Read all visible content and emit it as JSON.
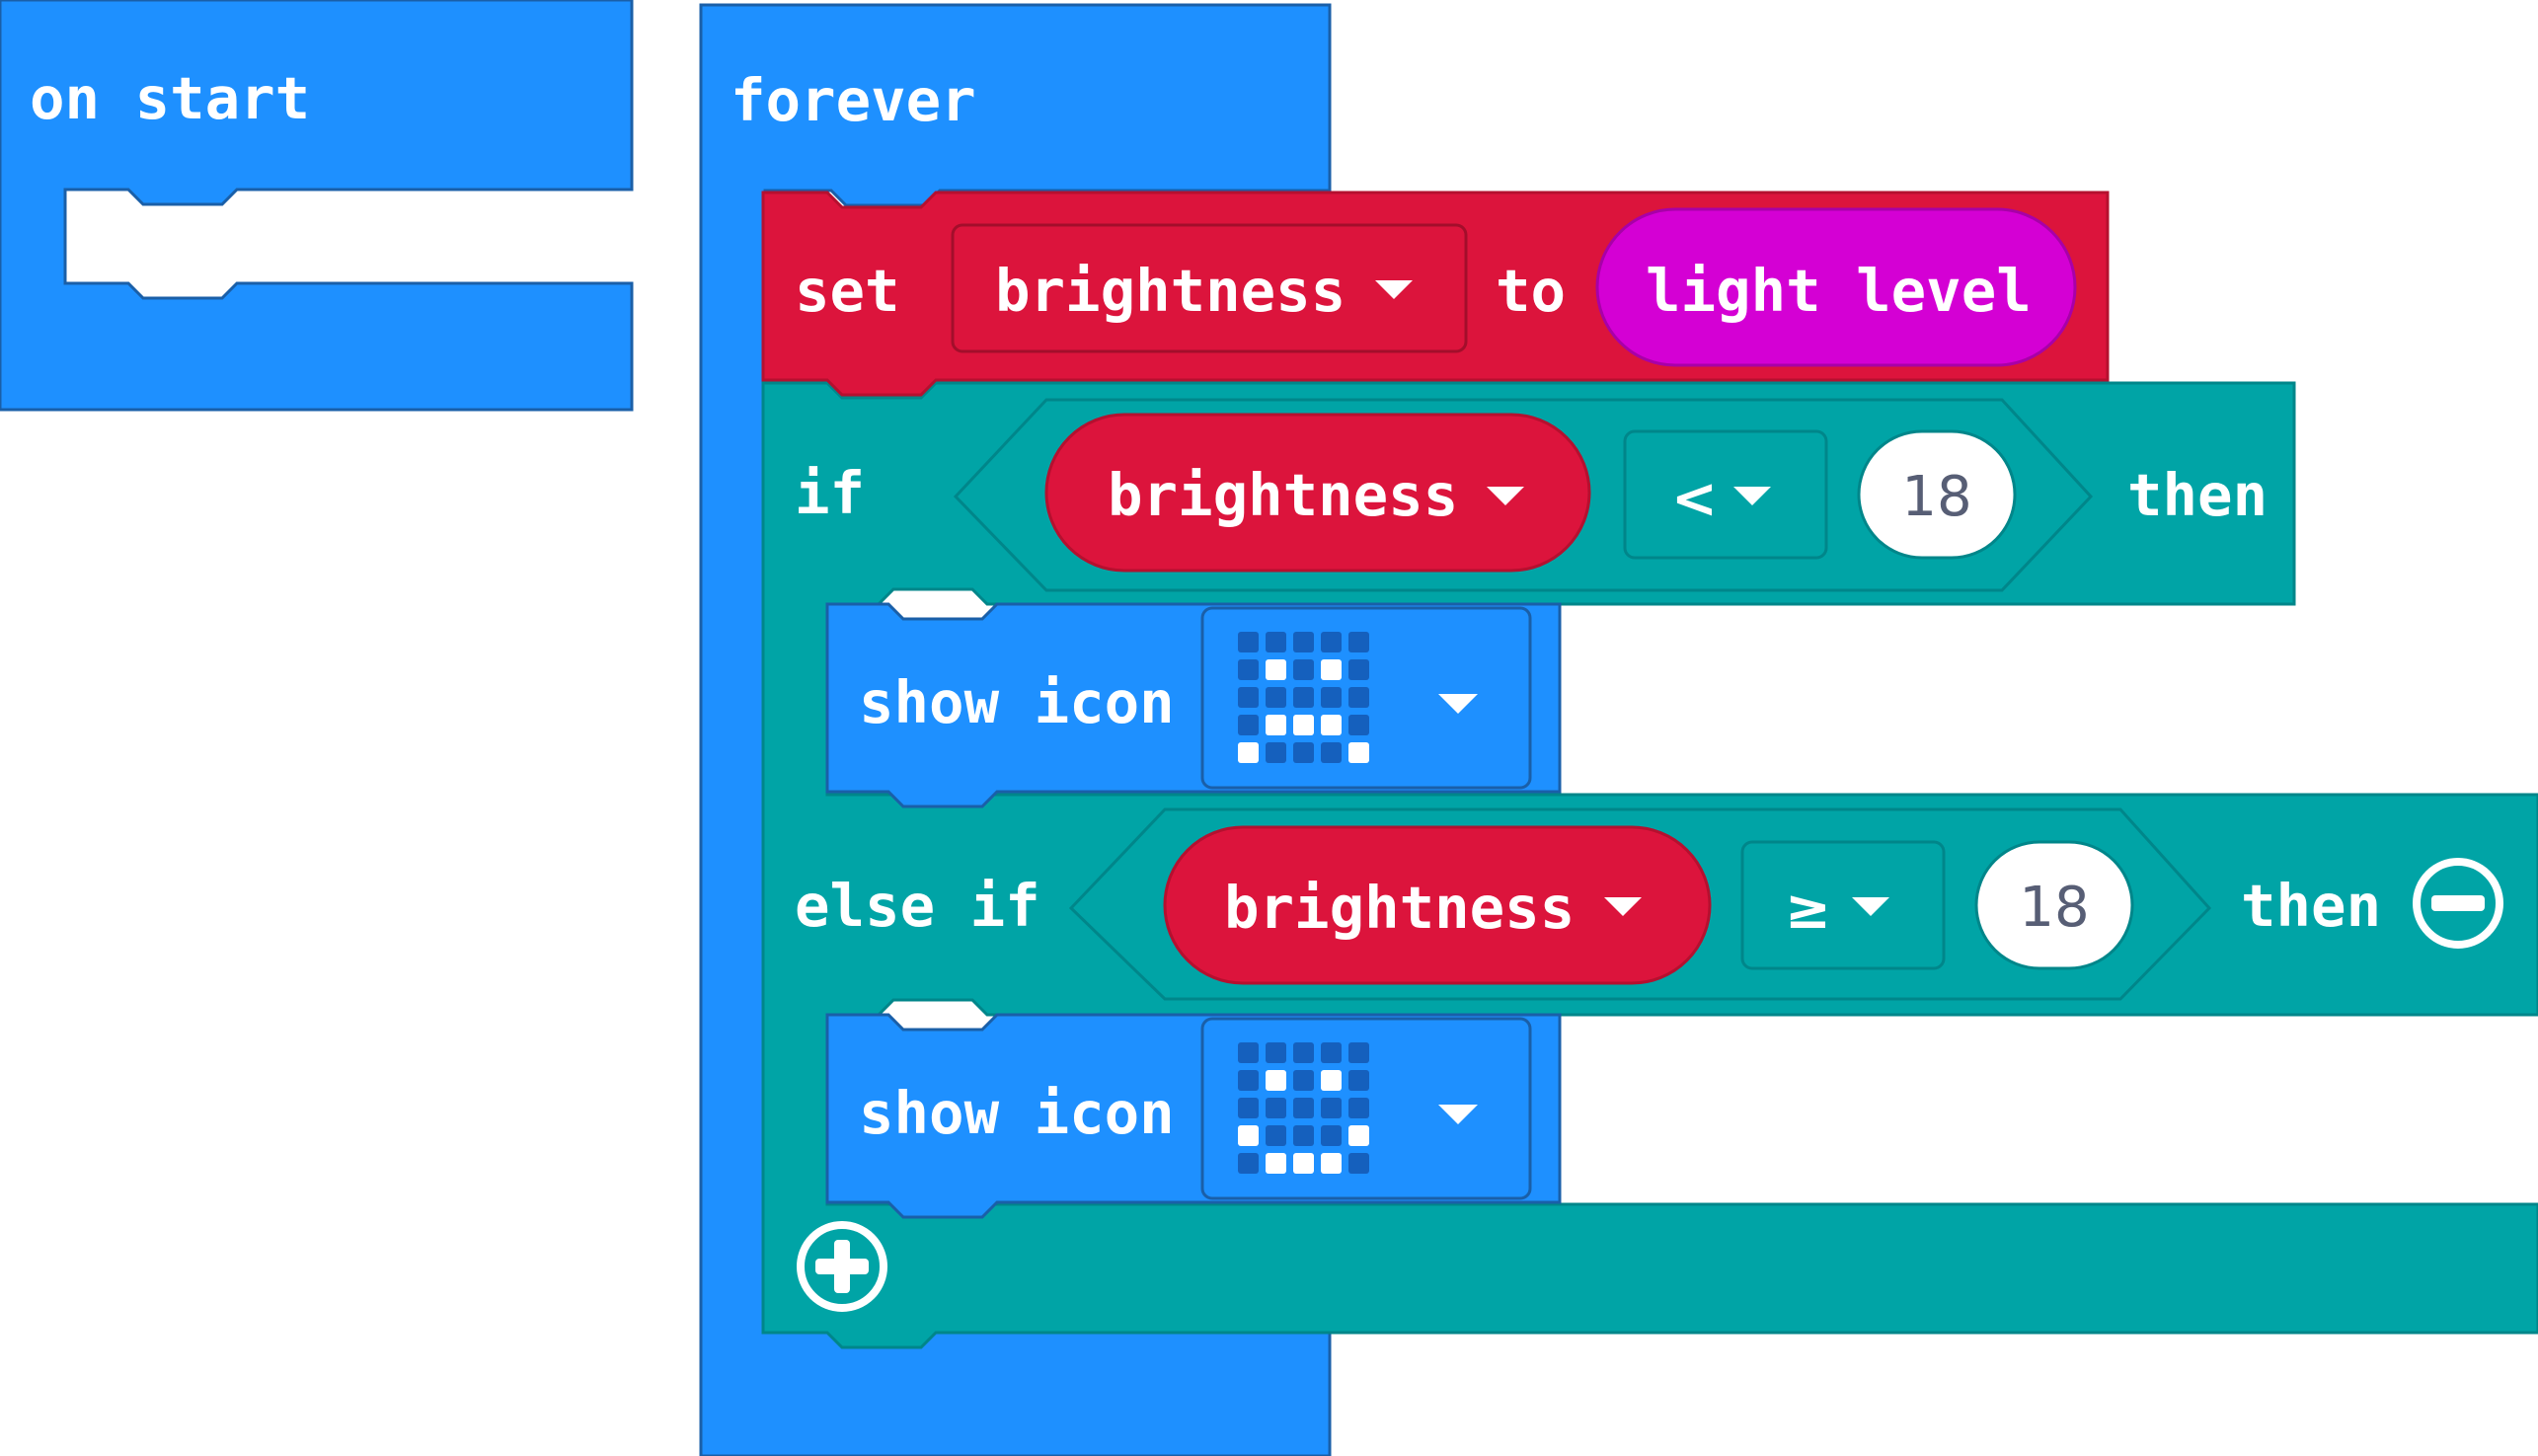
{
  "colors": {
    "loops_blue": "#1E90FF",
    "variables_red": "#DC143C",
    "logic_teal": "#00A4A6",
    "input_magenta": "#D400D4",
    "stroke_dark": "#1A5FA8"
  },
  "on_start": {
    "label": "on start"
  },
  "forever": {
    "label": "forever",
    "set_block": {
      "set_label": "set",
      "variable": "brightness",
      "to_label": "to",
      "value_reporter": "light level"
    },
    "if_block": {
      "if_label": "if",
      "condition": {
        "variable": "brightness",
        "operator": "<",
        "value": "18"
      },
      "then_label": "then",
      "show_icon": {
        "label": "show icon",
        "icon_grid": [
          [
            0,
            0,
            0,
            0,
            0
          ],
          [
            0,
            1,
            0,
            1,
            0
          ],
          [
            0,
            0,
            0,
            0,
            0
          ],
          [
            0,
            1,
            1,
            1,
            0
          ],
          [
            1,
            0,
            0,
            0,
            1
          ]
        ]
      },
      "else_if_label": "else if",
      "else_if_condition": {
        "variable": "brightness",
        "operator": "≥",
        "value": "18"
      },
      "else_if_then_label": "then",
      "else_if_show_icon": {
        "label": "show icon",
        "icon_grid": [
          [
            0,
            0,
            0,
            0,
            0
          ],
          [
            0,
            1,
            0,
            1,
            0
          ],
          [
            0,
            0,
            0,
            0,
            0
          ],
          [
            1,
            0,
            0,
            0,
            1
          ],
          [
            0,
            1,
            1,
            1,
            0
          ]
        ]
      },
      "remove_icon": "minus-circle-icon",
      "add_icon": "plus-circle-icon"
    }
  }
}
